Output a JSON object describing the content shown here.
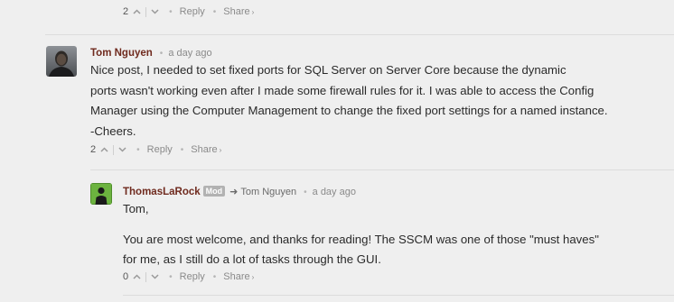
{
  "previous_comment": {
    "vote_count": "2",
    "reply_label": "Reply",
    "share_label": "Share"
  },
  "comment_1": {
    "author": "Tom Nguyen",
    "timestamp": "a day ago",
    "avatar_icon": "user-photo-avatar",
    "lines": [
      "Nice post, I needed to set fixed ports for SQL Server on Server Core because the dynamic",
      "ports wasn't working even after I made some firewall rules for it. I was able to access the Config",
      "Manager using the Computer Management to change the fixed port settings for a named instance.",
      "-Cheers."
    ],
    "vote_count": "2",
    "reply_label": "Reply",
    "share_label": "Share"
  },
  "comment_2": {
    "author": "ThomasLaRock",
    "badge": "Mod",
    "reply_to": "Tom Nguyen",
    "timestamp": "a day ago",
    "avatar_icon": "user-silhouette-avatar",
    "paragraphs": [
      [
        "Tom,"
      ],
      [
        "You are most welcome, and thanks for reading! The SSCM was one of those \"must haves\"",
        "for me, as I still do a lot of tasks through the GUI."
      ]
    ],
    "vote_count": "0",
    "reply_label": "Reply",
    "share_label": "Share"
  },
  "colors": {
    "background": "#efefef",
    "author": "#6f2a1e",
    "muted": "#8a8a8a",
    "badge": "#b2b2b2",
    "mod_avatar_bg": "#6cb33f"
  }
}
